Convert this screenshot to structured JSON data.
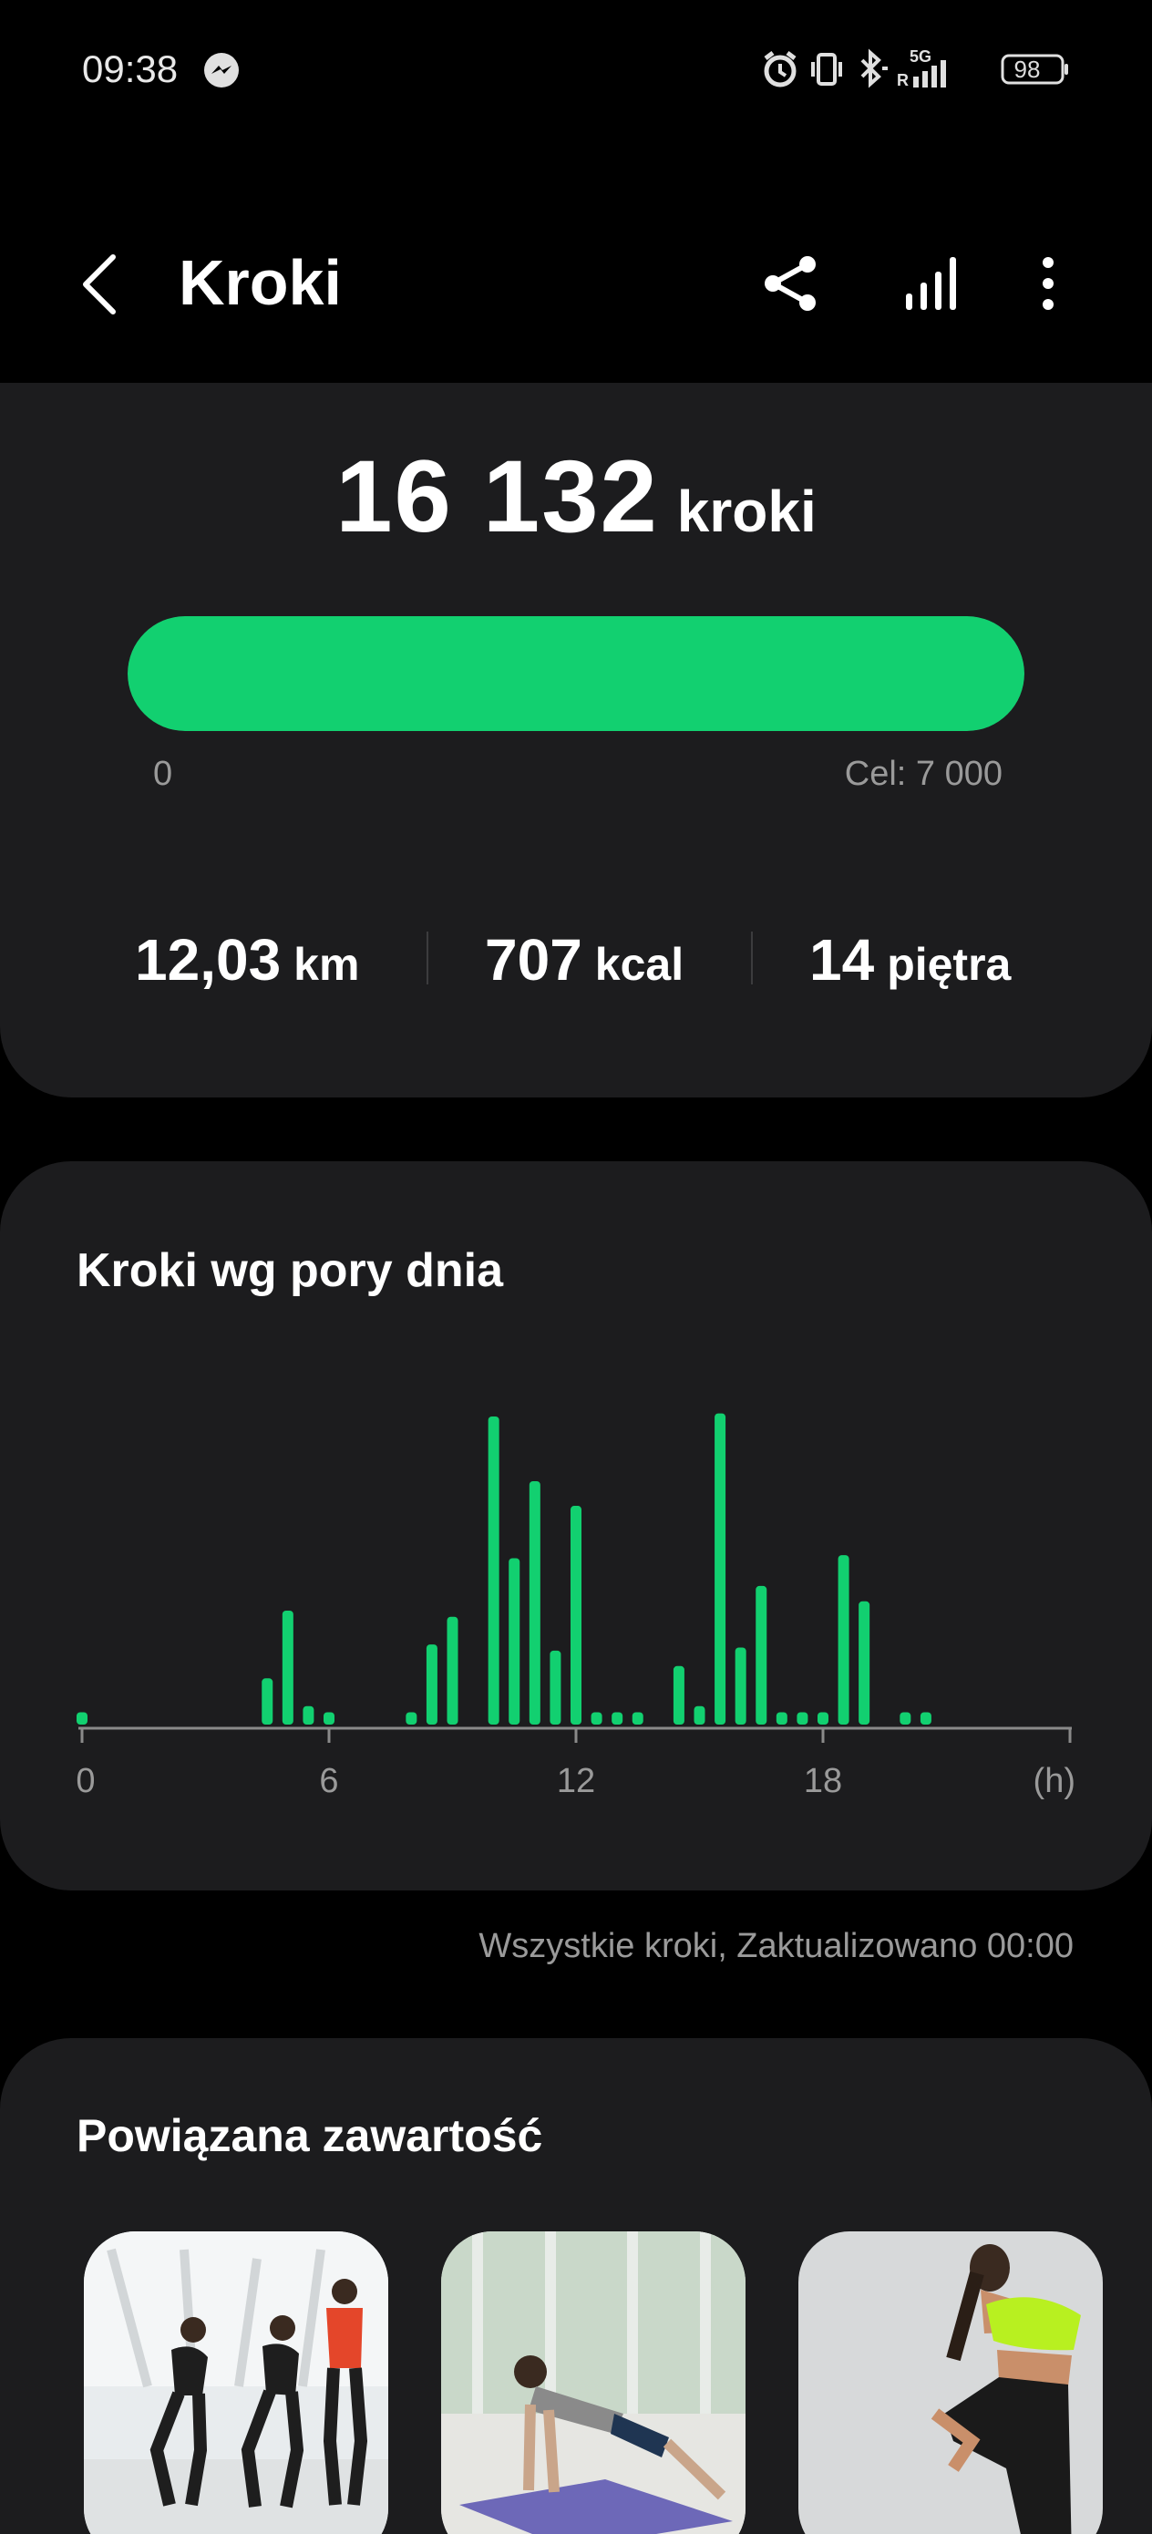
{
  "status_bar": {
    "time": "09:38",
    "battery": "98",
    "network_label": "5G"
  },
  "app_bar": {
    "title": "Kroki"
  },
  "steps": {
    "count": "16 132",
    "unit": "kroki",
    "progress_fraction": 1.0,
    "min_label": "0",
    "goal_label": "Cel: 7 000"
  },
  "metrics": [
    {
      "value": "12,03",
      "unit": "km"
    },
    {
      "value": "707",
      "unit": "kcal"
    },
    {
      "value": "14",
      "unit": "piętra"
    }
  ],
  "chart_data": {
    "type": "bar",
    "title": "Kroki wg pory dnia",
    "xlabel": "(h)",
    "xlim": [
      0,
      24
    ],
    "ylim": [
      0,
      100
    ],
    "x_ticks": [
      0,
      6,
      12,
      18
    ],
    "x_tick_labels": [
      "0",
      "6",
      "12",
      "18"
    ],
    "color": "#12d070",
    "x": [
      0,
      4.5,
      5,
      5.5,
      6,
      8.0,
      8.5,
      9,
      10,
      10.5,
      11,
      11.5,
      12,
      12.5,
      13,
      13.5,
      14.5,
      15,
      15.5,
      16,
      16.5,
      17,
      17.5,
      18,
      18.5,
      19,
      20,
      20.5
    ],
    "values": [
      4,
      15,
      37,
      6,
      4,
      4,
      26,
      35,
      100,
      54,
      79,
      24,
      71,
      4,
      4,
      4,
      19,
      6,
      101,
      25,
      45,
      4,
      4,
      4,
      55,
      40,
      4,
      4
    ]
  },
  "footnote": "Wszystkie kroki, Zaktualizowano 00:00",
  "related": {
    "title": "Powiązana zawartość",
    "items": [
      {
        "name": "thumb-group-stretch"
      },
      {
        "name": "thumb-pushup"
      },
      {
        "name": "thumb-quad-stretch"
      }
    ]
  }
}
